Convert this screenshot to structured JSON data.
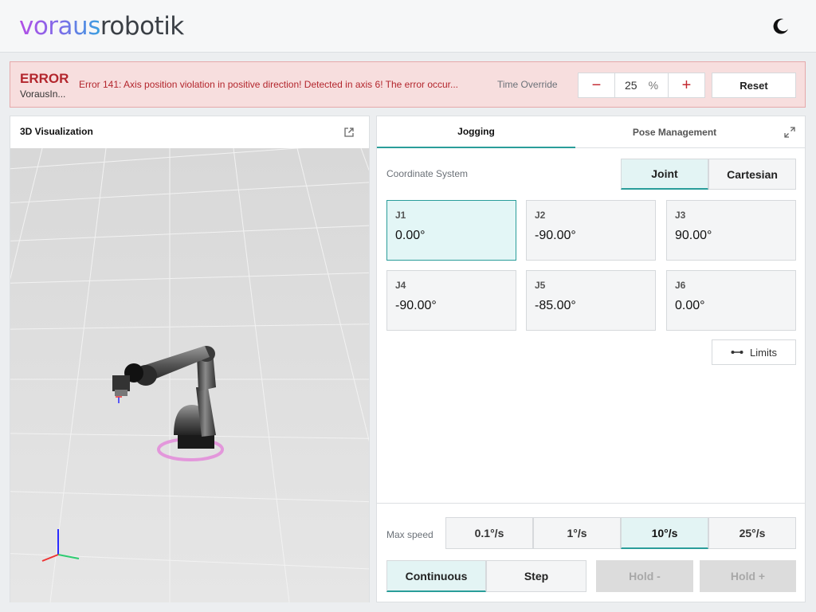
{
  "header": {
    "logo_part1": "voraus",
    "logo_part2": "robotik",
    "theme_icon": "moon-icon"
  },
  "error": {
    "title": "ERROR",
    "source": "VorausIn...",
    "message": "Error 141: Axis position violation in positive direction! Detected in axis 6! The error occur...",
    "time_override_label": "Time Override",
    "override_value": "25",
    "override_unit": "%",
    "minus": "−",
    "plus": "+",
    "reset_label": "Reset",
    "accent_color": "#b3262d"
  },
  "visualization": {
    "title": "3D Visualization",
    "popout_icon": "external-link-icon"
  },
  "jogging": {
    "tabs": [
      {
        "label": "Jogging",
        "active": true
      },
      {
        "label": "Pose Management",
        "active": false
      }
    ],
    "expand_icon": "expand-icon",
    "coordinate_label": "Coordinate System",
    "coordinate_options": [
      {
        "label": "Joint",
        "active": true
      },
      {
        "label": "Cartesian",
        "active": false
      }
    ],
    "joints": [
      {
        "name": "J1",
        "value": "0.00°",
        "active": true
      },
      {
        "name": "J2",
        "value": "-90.00°",
        "active": false
      },
      {
        "name": "J3",
        "value": "90.00°",
        "active": false
      },
      {
        "name": "J4",
        "value": "-90.00°",
        "active": false
      },
      {
        "name": "J5",
        "value": "-85.00°",
        "active": false
      },
      {
        "name": "J6",
        "value": "0.00°",
        "active": false
      }
    ],
    "limits_label": "Limits",
    "max_speed_label": "Max speed",
    "speeds": [
      {
        "label": "0.1°/s",
        "active": false
      },
      {
        "label": "1°/s",
        "active": false
      },
      {
        "label": "10°/s",
        "active": true
      },
      {
        "label": "25°/s",
        "active": false
      }
    ],
    "modes": [
      {
        "label": "Continuous",
        "active": true
      },
      {
        "label": "Step",
        "active": false
      }
    ],
    "hold_minus": "Hold -",
    "hold_plus": "Hold +",
    "accent_color": "#2a9d9a"
  }
}
